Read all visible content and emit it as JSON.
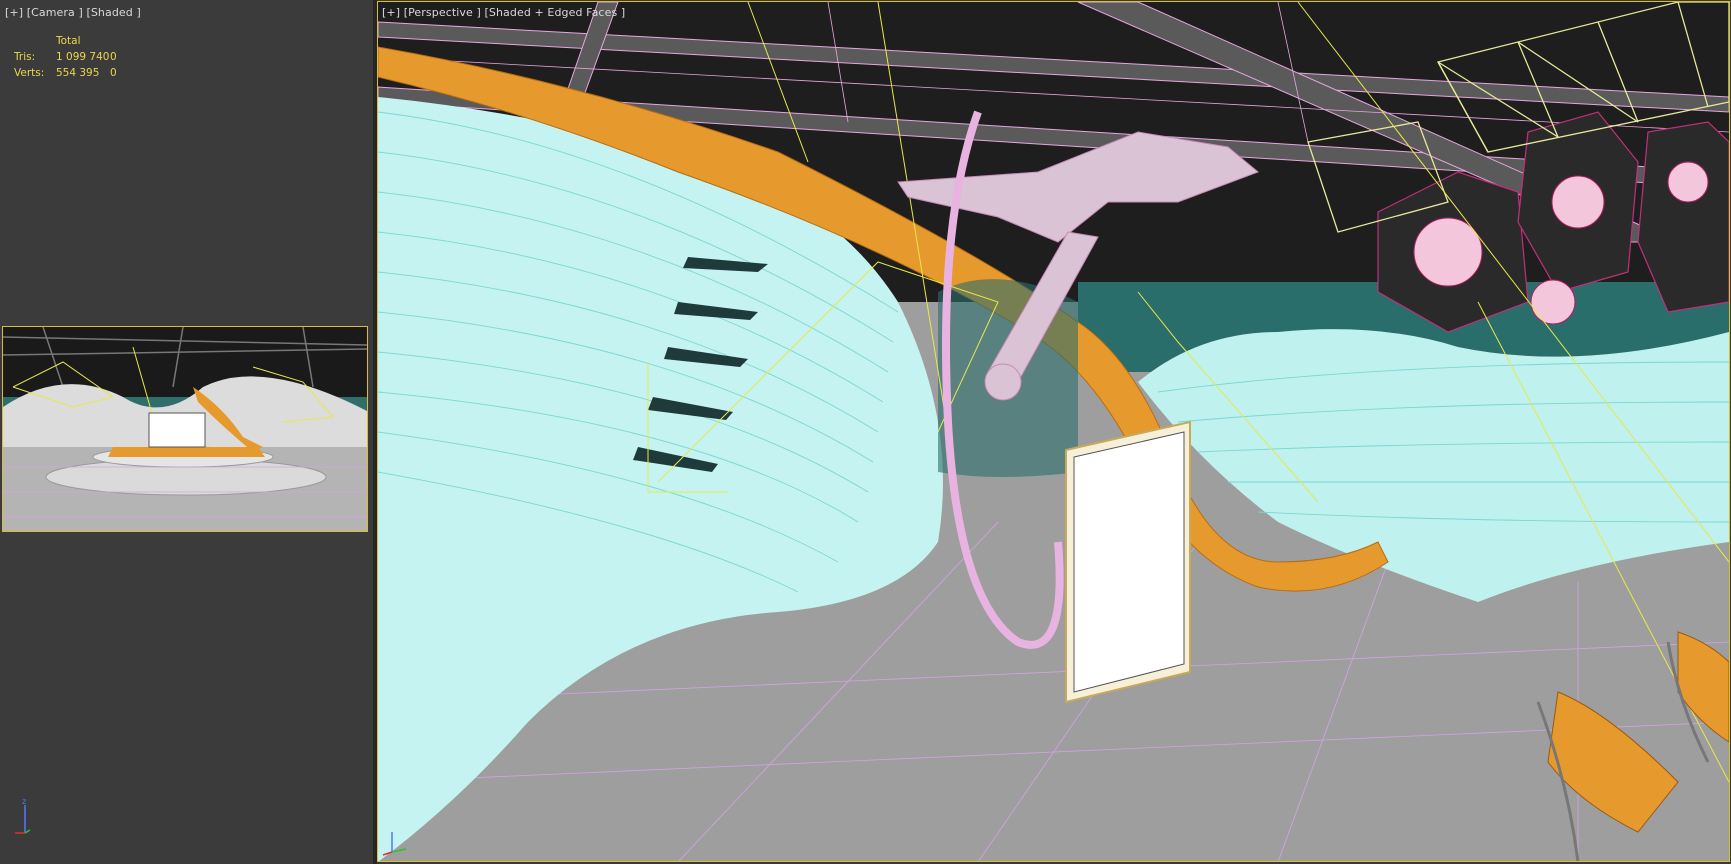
{
  "camera_viewport": {
    "label": "[+] [Camera ] [Shaded ]",
    "stats": {
      "header": "Total",
      "rows": [
        {
          "name": "Tris:",
          "total": "1 099 740",
          "selected": "0"
        },
        {
          "name": "Verts:",
          "total": "554 395",
          "selected": "0"
        }
      ]
    },
    "axis_label": "z"
  },
  "perspective_viewport": {
    "label": "[+] [Perspective ] [Shaded + Edged Faces ]"
  },
  "colors": {
    "active_border": "#d7c02c",
    "panel_bg": "#3b3b3b",
    "wire_cyan": "#9ef0ec",
    "wire_orange": "#e69a2e",
    "wire_pink": "#e89ad6",
    "wire_yellow": "#e8e84a",
    "floor": "#9e9e9e"
  }
}
